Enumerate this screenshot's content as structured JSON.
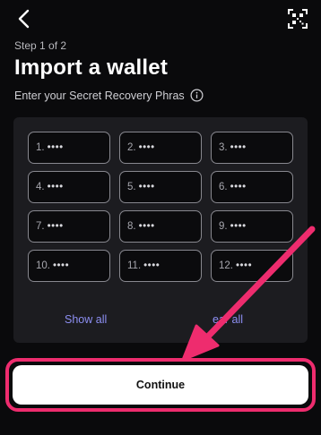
{
  "header": {
    "back_icon": "chevron-left-icon",
    "scan_icon": "qr-scan-icon"
  },
  "step": "Step 1 of 2",
  "title": "Import a wallet",
  "subtitle": "Enter your Secret Recovery Phras",
  "info_icon": "info-icon",
  "words": [
    {
      "num": "1.",
      "mask": "••••"
    },
    {
      "num": "2.",
      "mask": "••••"
    },
    {
      "num": "3.",
      "mask": "••••"
    },
    {
      "num": "4.",
      "mask": "••••"
    },
    {
      "num": "5.",
      "mask": "••••"
    },
    {
      "num": "6.",
      "mask": "••••"
    },
    {
      "num": "7.",
      "mask": "••••"
    },
    {
      "num": "8.",
      "mask": "••••"
    },
    {
      "num": "9.",
      "mask": "••••"
    },
    {
      "num": "10.",
      "mask": "••••"
    },
    {
      "num": "11.",
      "mask": "••••"
    },
    {
      "num": "12.",
      "mask": "••••"
    }
  ],
  "actions": {
    "show_all": "Show all",
    "clear_all": "ear all"
  },
  "continue_label": "Continue",
  "colors": {
    "background": "#0a0a0c",
    "panel": "#1c1c20",
    "link": "#8d8ff2",
    "annotation": "#ee2c6e"
  }
}
